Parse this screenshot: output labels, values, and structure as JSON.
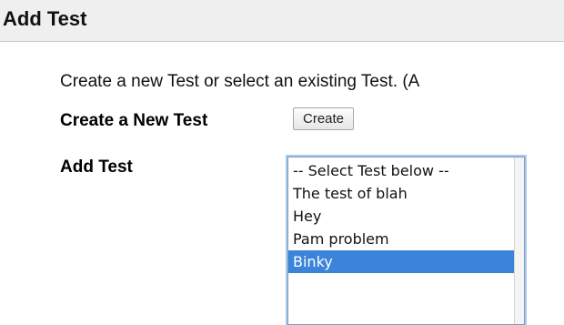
{
  "header": {
    "title": "Add Test"
  },
  "intro_text": "Create a new Test or select an existing Test. (A",
  "create_row": {
    "label": "Create a New Test",
    "button_label": "Create"
  },
  "add_row": {
    "label": "Add Test",
    "options": [
      "-- Select Test below --",
      "The test of blah",
      "Hey",
      "Pam problem",
      "Binky"
    ],
    "selected_value": "Binky"
  },
  "colors": {
    "header_background": "#efefef",
    "selection_highlight": "#3b84da",
    "focus_ring": "#a9c8ef"
  }
}
